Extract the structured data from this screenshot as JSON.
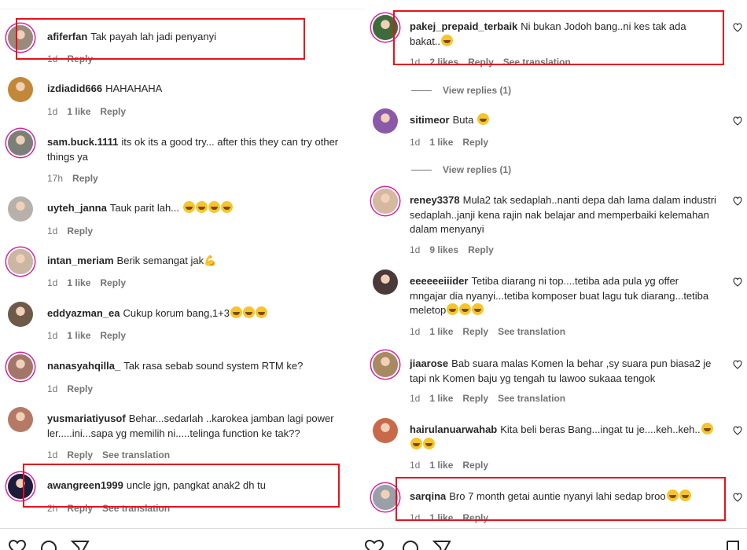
{
  "left_comments": [
    {
      "username": "afiferfan",
      "text": "Tak payah lah jadi penyanyi",
      "emojis": 0,
      "time": "1d",
      "likes": "",
      "reply": "Reply",
      "translate": "",
      "avatar": "#9a8a7c"
    },
    {
      "username": "izdiadid666",
      "text": "HAHAHAHA",
      "emojis": 0,
      "time": "1d",
      "likes": "1 like",
      "reply": "Reply",
      "translate": "",
      "avatar": "#c2883a"
    },
    {
      "username": "sam.buck.1111",
      "text": "its ok its a good try... after this they can try other things ya",
      "emojis": 0,
      "time": "17h",
      "likes": "",
      "reply": "Reply",
      "translate": "",
      "avatar": "#7c7f78"
    },
    {
      "username": "uyteh_janna",
      "text": "Tauk parit lah... ",
      "emojis": 4,
      "time": "1d",
      "likes": "",
      "reply": "Reply",
      "translate": "",
      "avatar": "#b8b0aa"
    },
    {
      "username": "intan_meriam",
      "text": "Berik semangat jak💪",
      "emojis": 0,
      "time": "1d",
      "likes": "1 like",
      "reply": "Reply",
      "translate": "",
      "avatar": "#c9b6a3"
    },
    {
      "username": "eddyazman_ea",
      "text": "Cukup korum bang,1+3",
      "emojis": 3,
      "time": "1d",
      "likes": "1 like",
      "reply": "Reply",
      "translate": "",
      "avatar": "#6d5a48"
    },
    {
      "username": "nanasyahqilla_",
      "text": "Tak rasa sebab sound system RTM ke?",
      "emojis": 0,
      "time": "1d",
      "likes": "",
      "reply": "Reply",
      "translate": "",
      "avatar": "#a3766a"
    },
    {
      "username": "yusmariatiyusof",
      "text": "Behar...sedarlah ..karokea jamban lagi power ler.....ini...sapa yg memilih ni.....telinga function ke tak??",
      "emojis": 0,
      "time": "1d",
      "likes": "",
      "reply": "Reply",
      "translate": "See translation",
      "avatar": "#b57a66"
    },
    {
      "username": "awangreen1999",
      "text": "uncle jgn, pangkat anak2 dh tu",
      "emojis": 0,
      "time": "2h",
      "likes": "",
      "reply": "Reply",
      "translate": "See translation",
      "avatar": "#1b1d3a"
    }
  ],
  "right_comments": [
    {
      "username": "pakej_prepaid_terbaik",
      "text": "Ni bukan Jodoh bang..ni kes tak ada bakat..",
      "emojis": 1,
      "time": "1d",
      "likes": "2 likes",
      "reply": "Reply",
      "translate": "See translation",
      "avatar": "#3f6b3a",
      "replies": "View replies (1)"
    },
    {
      "username": "sitimeor",
      "text": "Buta ",
      "emojis": 1,
      "time": "1d",
      "likes": "1 like",
      "reply": "Reply",
      "translate": "",
      "avatar": "#8a5aa8",
      "replies": "View replies (1)"
    },
    {
      "username": "reney3378",
      "text": "Mula2 tak sedaplah..nanti depa dah lama dalam industri sedaplah..janji kena rajin nak belajar and memperbaiki kelemahan dalam menyanyi",
      "emojis": 0,
      "time": "1d",
      "likes": "9 likes",
      "reply": "Reply",
      "translate": "",
      "avatar": "#d6b8a0",
      "replies": ""
    },
    {
      "username": "eeeeeeiiider",
      "text": "Tetiba diarang ni top....tetiba ada pula yg offer mngajar dia nyanyi...tetiba komposer buat lagu tuk diarang...tetiba meletop",
      "emojis": 3,
      "time": "1d",
      "likes": "1 like",
      "reply": "Reply",
      "translate": "See translation",
      "avatar": "#4a3a3a",
      "replies": ""
    },
    {
      "username": "jiaarose",
      "text": "Bab suara malas Komen la behar ,sy suara pun biasa2 je tapi nk Komen baju yg tengah tu lawoo sukaaa tengok",
      "emojis": 0,
      "time": "1d",
      "likes": "1 like",
      "reply": "Reply",
      "translate": "See translation",
      "avatar": "#a88a62",
      "replies": ""
    },
    {
      "username": "hairulanuarwahab",
      "text": "Kita beli beras Bang...ingat tu je....keh..keh..",
      "emojis": 3,
      "time": "1d",
      "likes": "1 like",
      "reply": "Reply",
      "translate": "",
      "avatar": "#c86a4a",
      "replies": ""
    },
    {
      "username": "sarqina",
      "text": "Bro 7 month getai auntie nyanyi lahi sedap broo",
      "emojis": 2,
      "time": "1d",
      "likes": "1 like",
      "reply": "Reply",
      "translate": "",
      "avatar": "#9aa0a8",
      "replies": ""
    }
  ],
  "icons": {
    "heart": "heart-icon",
    "comment": "comment-icon",
    "share": "send-icon",
    "save": "bookmark-icon"
  },
  "colors": {
    "highlight": "#e8101c",
    "meta": "#737373",
    "text": "#262626"
  }
}
